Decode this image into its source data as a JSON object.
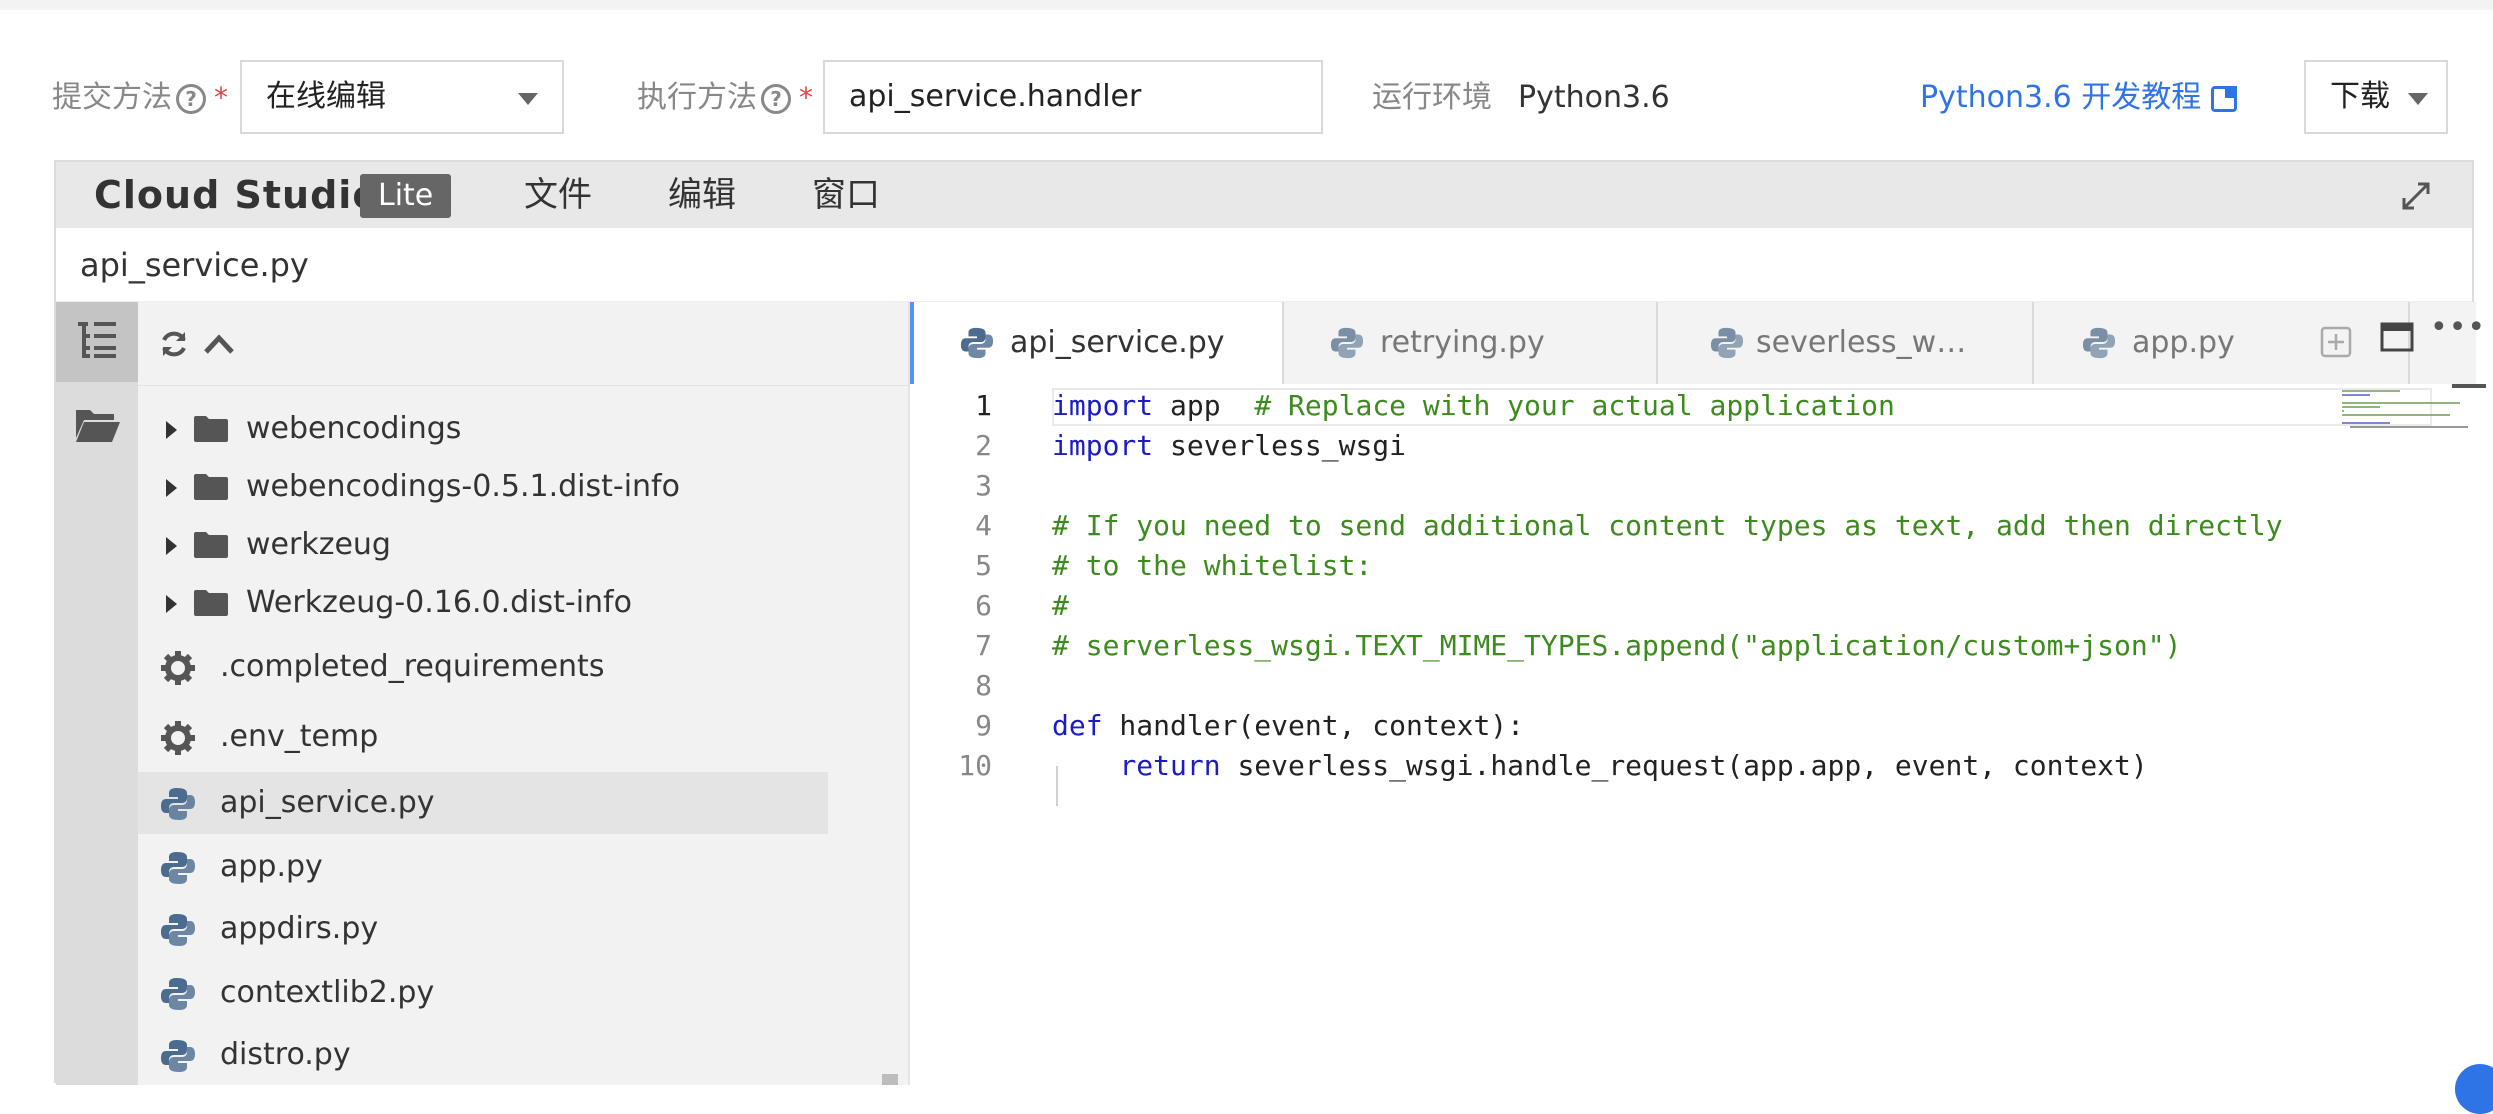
{
  "form": {
    "submit_label": "提交方法",
    "submit_value": "在线编辑",
    "exec_label": "执行方法",
    "exec_value": "api_service.handler",
    "runtime_label": "运行环境",
    "runtime_value": "Python3.6",
    "tutorial_link": "Python3.6 开发教程",
    "download_label": "下载",
    "required_mark": "*",
    "help_mark": "?"
  },
  "ide": {
    "brand": "Cloud Studio",
    "badge": "Lite",
    "menu": [
      "文件",
      "编辑",
      "窗口"
    ],
    "current_file": "api_service.py"
  },
  "explorer": {
    "items": [
      {
        "type": "folder",
        "name": "webencodings"
      },
      {
        "type": "folder",
        "name": "webencodings-0.5.1.dist-info"
      },
      {
        "type": "folder",
        "name": "werkzeug"
      },
      {
        "type": "folder",
        "name": "Werkzeug-0.16.0.dist-info"
      },
      {
        "type": "config",
        "name": ".completed_requirements"
      },
      {
        "type": "config",
        "name": ".env_temp"
      },
      {
        "type": "python",
        "name": "api_service.py",
        "selected": true
      },
      {
        "type": "python",
        "name": "app.py"
      },
      {
        "type": "python",
        "name": "appdirs.py"
      },
      {
        "type": "python",
        "name": "contextlib2.py"
      },
      {
        "type": "python",
        "name": "distro.py"
      }
    ]
  },
  "tabs": [
    {
      "name": "api_service.py",
      "active": true
    },
    {
      "name": "retrying.py"
    },
    {
      "name": "severless_w…"
    },
    {
      "name": "app.py"
    }
  ],
  "code": {
    "line_numbers": [
      "1",
      "2",
      "3",
      "4",
      "5",
      "6",
      "7",
      "8",
      "9",
      "10"
    ],
    "l1_kw": "import",
    "l1_rest": " app  ",
    "l1_cm": "# Replace with your actual application",
    "l2_kw": "import",
    "l2_rest": " severless_wsgi",
    "l4_cm": "# If you need to send additional content types as text, add then directly",
    "l5_cm": "# to the whitelist:",
    "l6_cm": "#",
    "l7_cm": "# serverless_wsgi.TEXT_MIME_TYPES.append(\"application/custom+json\")",
    "l9_kw": "def",
    "l9_rest": " handler(event, context):",
    "l10_indent": "    ",
    "l10_kw": "return",
    "l10_rest": " severless_wsgi.handle_request(app.app, event, context)"
  },
  "colors": {
    "accent_blue": "#2f74e6",
    "keyword": "#1b1bc8",
    "comment": "#3d8a1e",
    "python_icon": "#4b6b8f"
  }
}
